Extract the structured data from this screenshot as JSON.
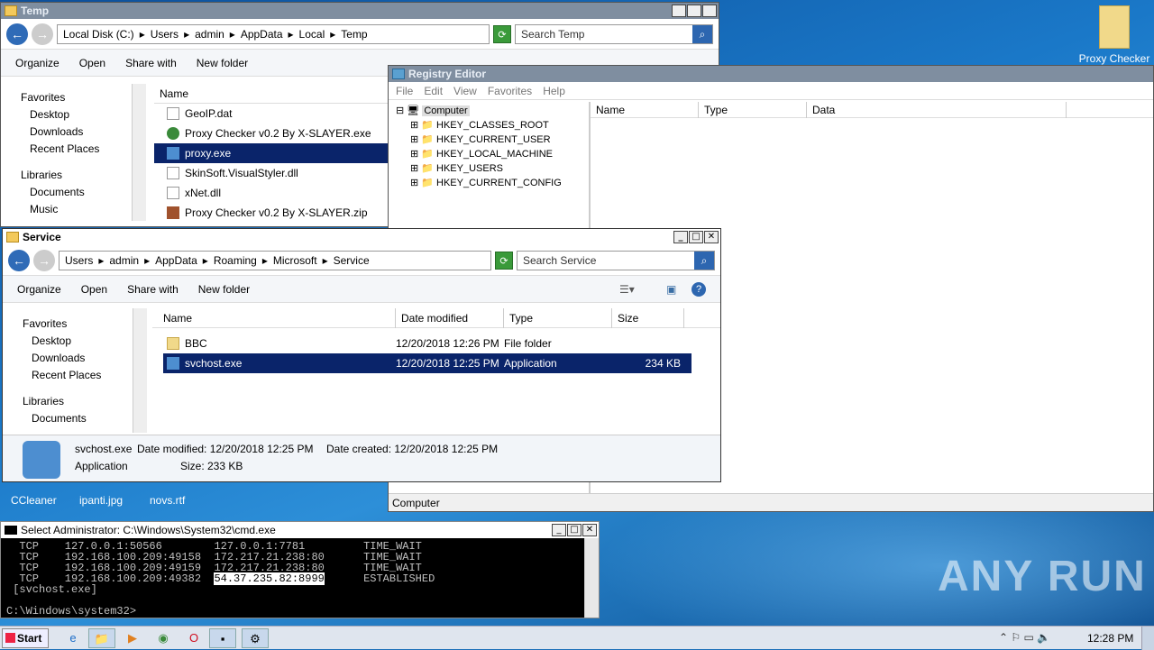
{
  "desktop": {
    "icon_label": "Proxy Checker",
    "bottom_icons": [
      "CCleaner",
      "ipanti.jpg",
      "novs.rtf"
    ],
    "watermark": "ANY RUN"
  },
  "temp": {
    "title": "Temp",
    "breadcrumb": [
      "Local Disk (C:)",
      "Users",
      "admin",
      "AppData",
      "Local",
      "Temp"
    ],
    "search_placeholder": "Search Temp",
    "toolbar": [
      "Organize",
      "Open",
      "Share with",
      "New folder"
    ],
    "nav": [
      "Favorites",
      "Desktop",
      "Downloads",
      "Recent Places",
      "Libraries",
      "Documents",
      "Music"
    ],
    "col_name": "Name",
    "files": [
      "GeoIP.dat",
      "Proxy Checker v0.2 By X-SLAYER.exe",
      "proxy.exe",
      "SkinSoft.VisualStyler.dll",
      "xNet.dll",
      "Proxy Checker v0.2 By X-SLAYER.zip"
    ]
  },
  "registry": {
    "title": "Registry Editor",
    "menu": [
      "File",
      "Edit",
      "View",
      "Favorites",
      "Help"
    ],
    "root": "Computer",
    "keys": [
      "HKEY_CLASSES_ROOT",
      "HKEY_CURRENT_USER",
      "HKEY_LOCAL_MACHINE",
      "HKEY_USERS",
      "HKEY_CURRENT_CONFIG"
    ],
    "cols": [
      "Name",
      "Type",
      "Data"
    ],
    "status": "Computer"
  },
  "service": {
    "title": "Service",
    "breadcrumb": [
      "Users",
      "admin",
      "AppData",
      "Roaming",
      "Microsoft",
      "Service"
    ],
    "search_placeholder": "Search Service",
    "toolbar": [
      "Organize",
      "Open",
      "Share with",
      "New folder"
    ],
    "nav": [
      "Favorites",
      "Desktop",
      "Downloads",
      "Recent Places",
      "Libraries",
      "Documents"
    ],
    "cols": [
      "Name",
      "Date modified",
      "Type",
      "Size"
    ],
    "rows": [
      {
        "name": "BBC",
        "date": "12/20/2018 12:26 PM",
        "type": "File folder",
        "size": ""
      },
      {
        "name": "svchost.exe",
        "date": "12/20/2018 12:25 PM",
        "type": "Application",
        "size": "234 KB"
      }
    ],
    "details": {
      "name": "svchost.exe",
      "modified": "Date modified: 12/20/2018 12:25 PM",
      "created": "Date created: 12/20/2018 12:25 PM",
      "type": "Application",
      "size": "Size: 233 KB"
    }
  },
  "cmd": {
    "title": "Select Administrator: C:\\Windows\\System32\\cmd.exe",
    "lines": [
      "  TCP    127.0.0.1:50566        127.0.0.1:7781         TIME_WAIT",
      "  TCP    192.168.100.209:49158  172.217.21.238:80      TIME_WAIT",
      "  TCP    192.168.100.209:49159  172.217.21.238:80      TIME_WAIT",
      "  TCP    192.168.100.209:49382  54.37.235.82:8999      ESTABLISHED",
      " [svchost.exe]",
      "",
      "C:\\Windows\\system32>"
    ]
  },
  "taskbar": {
    "start": "Start",
    "clock": "12:28 PM"
  }
}
